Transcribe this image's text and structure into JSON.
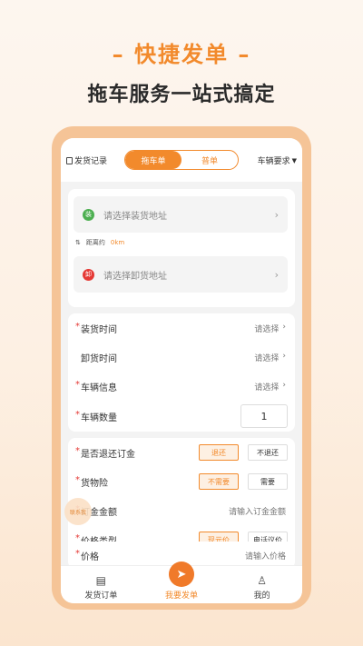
{
  "promo": {
    "headline": "– 快捷发单 –",
    "subline": "拖车服务一站式搞定"
  },
  "topbar": {
    "records_label": "发货记录",
    "tabs": [
      "拖车单",
      "普单"
    ],
    "active_tab": 0,
    "vehicle_req": "车辆要求"
  },
  "address": {
    "load_placeholder": "请选择装货地址",
    "unload_placeholder": "请选择卸货地址",
    "distance_label": "距离约",
    "distance_value": "0km",
    "load_icon_text": "装",
    "unload_icon_text": "卸"
  },
  "schedule": {
    "load_time": {
      "label": "装货时间",
      "value": "请选择",
      "required": "*"
    },
    "unload_time": {
      "label": "卸货时间",
      "value": "请选择"
    },
    "vehicle_info": {
      "label": "车辆信息",
      "value": "请选择",
      "required": "*"
    },
    "vehicle_count": {
      "label": "车辆数量",
      "value": "1",
      "required": "*"
    }
  },
  "options": {
    "deposit": {
      "label": "是否退还订金",
      "required": "*",
      "opts": [
        "退还",
        "不退还"
      ],
      "selected": 0
    },
    "insurance": {
      "label": "货物险",
      "required": "*",
      "opts": [
        "不需要",
        "需要"
      ],
      "selected": 0
    },
    "deposit_amount": {
      "label": "订金金额",
      "placeholder": "请输入订金金额",
      "required": "*"
    },
    "price_type": {
      "label": "价格类型",
      "required": "*",
      "opts": [
        "现元价",
        "电话议价"
      ],
      "selected": 0
    },
    "price": {
      "label": "价格",
      "placeholder": "请输入价格",
      "required": "*"
    }
  },
  "badge": {
    "label": "联系我"
  },
  "tabbar": {
    "items": [
      "发货订单",
      "我要发单",
      "我的"
    ],
    "active": 1
  },
  "colors": {
    "accent": "#f28a2c",
    "required": "#e53935"
  }
}
